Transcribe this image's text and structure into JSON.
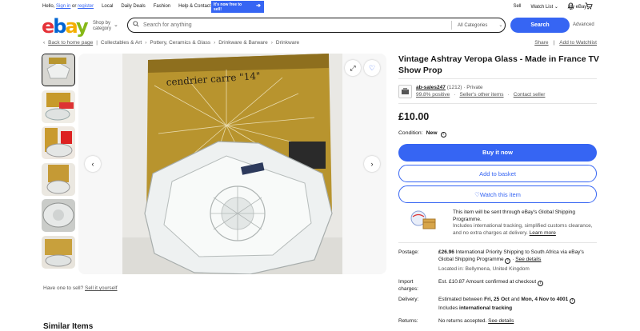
{
  "topbar": {
    "greeting_pre": "Hello,",
    "sign_in": "Sign in",
    "or": "or",
    "register": "register",
    "links": [
      "Local",
      "Daily Deals",
      "Fashion",
      "Help & Contact"
    ],
    "promo": "It's now free to sell!",
    "right_links": [
      "Sell",
      "Watch List",
      "My eBay"
    ]
  },
  "header": {
    "logo": [
      "e",
      "b",
      "a",
      "y"
    ],
    "category_label": "Shop by category",
    "search_placeholder": "Search for anything",
    "category_select": "All Categories",
    "search_button": "Search",
    "advanced": "Advanced"
  },
  "breadcrumb": {
    "back": "Back to home page",
    "items": [
      "Collectables & Art",
      "Pottery, Ceramics & Glass",
      "Drinkware & Barware",
      "Drinkware"
    ],
    "share": "Share",
    "watchlist": "Add to Watchlist"
  },
  "gallery": {
    "box_text": "cendrier carre \"14\"",
    "below": "Have one to sell?",
    "sell_link": "Sell it yourself",
    "similar": "Similar Items"
  },
  "listing": {
    "title": "Vintage Ashtray Veropa Glass - Made in France TV Show Prop",
    "seller_name": "ab-sales247",
    "seller_count": "(1212)",
    "seller_type": "· Private",
    "feedback": "99.8% positive",
    "other_items": "Seller's other items",
    "contact": "Contact seller",
    "price": "£10.00",
    "condition_label": "Condition:",
    "condition_value": "New",
    "buy_now": "Buy it now",
    "add_basket": "Add to basket",
    "watch": "Watch this item",
    "gsp_line1": "This item will be sent through eBay's Global Shipping Programme.",
    "gsp_line2": "Includes international tracking, simplified customs clearance, and no extra charges at delivery.",
    "learn_more": "Learn more",
    "postage_label": "Postage:",
    "postage_price": "£26.96",
    "postage_desc": "International Priority Shipping to South Africa via eBay's Global Shipping Programme",
    "see_details": "See details",
    "located": "Located in: Bellymena, United Kingdom",
    "import_label": "Import charges:",
    "import_value": "Est. £10.87 Amount confirmed at checkout",
    "delivery_label": "Delivery:",
    "delivery_pre": "Estimated between",
    "delivery_from": "Fri, 25 Oct",
    "delivery_and": "and",
    "delivery_to": "Mon, 4 Nov to 4001",
    "delivery_tracking_pre": "Includes",
    "delivery_tracking": "international tracking",
    "returns_label": "Returns:",
    "returns_value": "No returns accepted.",
    "returns_details": "See details"
  }
}
